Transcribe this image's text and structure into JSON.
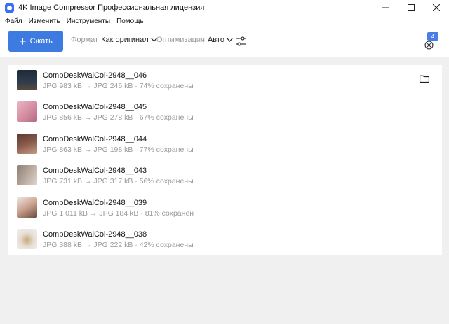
{
  "window": {
    "title": "4K Image Compressor Профессиональная лицензия"
  },
  "menu": [
    "Файл",
    "Изменить",
    "Инструменты",
    "Помощь"
  ],
  "toolbar": {
    "compress_label": "Сжать",
    "format_label": "Формат",
    "format_value": "Как оригинал",
    "optimization_label": "Оптимизация",
    "optimization_value": "Авто",
    "compare_count": "4"
  },
  "files": [
    {
      "name": "CompDeskWalCol-2948__046",
      "info": "JPG 983 kB → JPG 246 kB · 74% сохранены",
      "thumb_color": "#2b3a4e"
    },
    {
      "name": "CompDeskWalCol-2948__045",
      "info": "JPG 856 kB → JPG 278 kB · 67% сохранены",
      "thumb_color": "#d68fa4"
    },
    {
      "name": "CompDeskWalCol-2948__044",
      "info": "JPG 863 kB → JPG 198 kB · 77% сохранены",
      "thumb_color": "#8a5a4a"
    },
    {
      "name": "CompDeskWalCol-2948__043",
      "info": "JPG 731 kB → JPG 317 kB · 56% сохранены",
      "thumb_color": "#b9a89c"
    },
    {
      "name": "CompDeskWalCol-2948__039",
      "info": "JPG 1 011 kB → JPG 184 kB · 81% сохранен",
      "thumb_color": "#c99f8c"
    },
    {
      "name": "CompDeskWalCol-2948__038",
      "info": "JPG 388 kB → JPG 222 kB · 42% сохранены",
      "thumb_color": "#e4ddd3"
    }
  ],
  "colors": {
    "accent": "#3d7be0",
    "badge": "#4a7de8",
    "muted": "#9a9a9a"
  }
}
